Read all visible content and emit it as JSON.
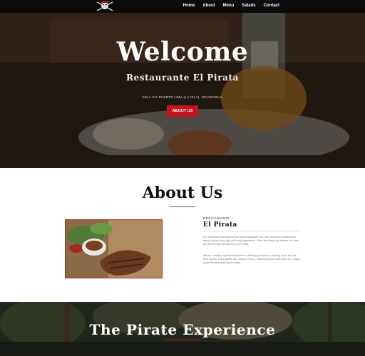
{
  "nav": {
    "items": [
      "Home",
      "About",
      "Menu",
      "Salads",
      "Contact"
    ]
  },
  "hero": {
    "title": "Welcome",
    "subtitle": "Restaurante El Pirata",
    "address": "KM 4 VIA PUERTO LIMA (LA ISLA), NICARAGUA",
    "button": "ABOUT US"
  },
  "about": {
    "title": "About Us",
    "kicker": "RESTAURANTE",
    "name": "El Pirata",
    "paragraph1": "Our restaurant is located on the island facing the sea. We cook fresh seafood and typical dishes every day with local ingredients. Come and enjoy the breeze, the view and the friendly atmosphere of El Pirata.",
    "paragraph2": "We are a family business dedicated to offering good food, a relaxing place and the best service. Enjoy grilled fish, lobster, shrimp, cold drinks and much more in a unique pirate themed place by the water."
  },
  "experience": {
    "title": "The Pirate Experience"
  },
  "colors": {
    "accent": "#c4161c",
    "nav_bg": "#0b0b0b",
    "heading": "#111111"
  }
}
